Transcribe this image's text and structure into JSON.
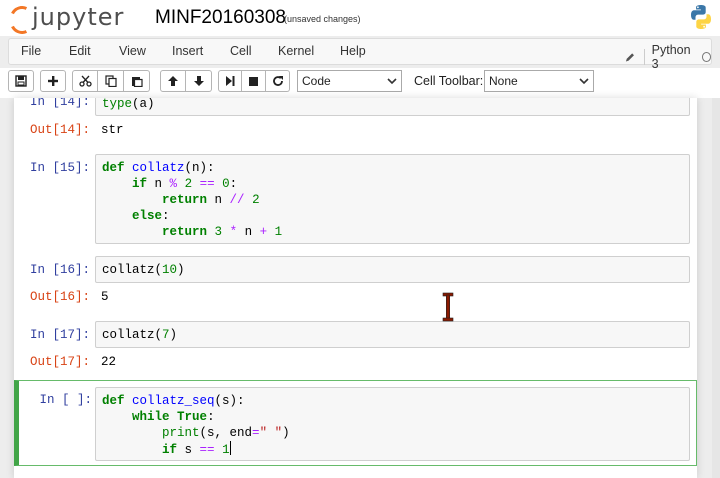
{
  "header": {
    "brand": "jupyter",
    "notebook_name": "MINF20160308",
    "save_status": "(unsaved changes)"
  },
  "menubar": {
    "items": [
      "File",
      "Edit",
      "View",
      "Insert",
      "Cell",
      "Kernel",
      "Help"
    ],
    "kernel_name": "Python 3"
  },
  "toolbar": {
    "cell_type": "Code",
    "cell_toolbar_label": "Cell Toolbar:",
    "cell_toolbar_value": "None"
  },
  "cells": [
    {
      "in_prompt": "In [14]:",
      "out_prompt": "Out[14]:",
      "output": "str"
    },
    {
      "in_prompt": "In [15]:"
    },
    {
      "in_prompt": "In [16]:",
      "out_prompt": "Out[16]:",
      "output": "5"
    },
    {
      "in_prompt": "In [17]:",
      "out_prompt": "Out[17]:",
      "output": "22"
    },
    {
      "in_prompt": "In [ ]:"
    }
  ],
  "code": {
    "c14": {
      "fn": "type",
      "arg": "a"
    },
    "c15": {
      "l1_kw": "def",
      "l1_fn": "collatz",
      "l1_rest": "(n):",
      "l2_kw": "if",
      "l2_a": " n ",
      "l2_op1": "%",
      "l2_num1": "2",
      "l2_op2": "==",
      "l2_num2": "0",
      "l2_end": ":",
      "l3_kw": "return",
      "l3_a": " n ",
      "l3_op": "//",
      "l3_num": "2",
      "l4_kw": "else",
      "l4_end": ":",
      "l5_kw": "return",
      "l5_num1": "3",
      "l5_op1": "*",
      "l5_a": " n ",
      "l5_op2": "+",
      "l5_num2": "1"
    },
    "c16": {
      "fn": "collatz",
      "arg": "10"
    },
    "c17": {
      "fn": "collatz",
      "arg": "7"
    },
    "c18": {
      "l1_kw": "def",
      "l1_fn": "collatz_seq",
      "l1_rest": "(s):",
      "l2_kw": "while",
      "l2_true": "True",
      "l2_end": ":",
      "l3_bi": "print",
      "l3_a": "(s, end",
      "l3_op": "=",
      "l3_str": "\" \"",
      "l3_end": ")",
      "l4_kw": "if",
      "l4_a": " s ",
      "l4_op": "==",
      "l4_num": "1"
    }
  },
  "colors": {
    "in_prompt": "#303f9f",
    "out_prompt": "#d84315",
    "selected_border": "#42a548",
    "logo_orange": "#f37726"
  }
}
